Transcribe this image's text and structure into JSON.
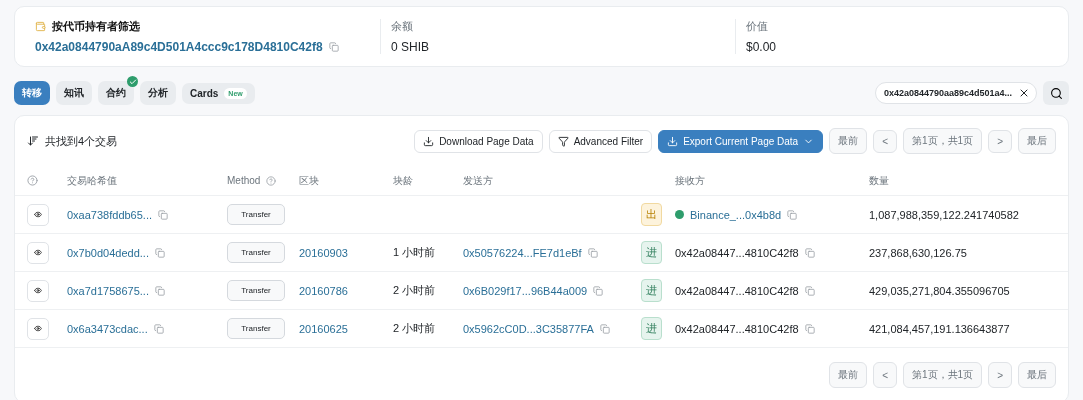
{
  "summary": {
    "filter": {
      "title": "按代币持有者筛选",
      "address": "0x42a0844790aA89c4D501A4ccc9c178D4810C42f8"
    },
    "balance": {
      "label": "余额",
      "value": "0 SHIB"
    },
    "value": {
      "label": "价值",
      "value": "$0.00"
    }
  },
  "tabs": [
    {
      "label": "转移",
      "selected": true,
      "verified": false
    },
    {
      "label": "知讯",
      "selected": false,
      "verified": false
    },
    {
      "label": "合约",
      "selected": false,
      "verified": true
    },
    {
      "label": "分析",
      "selected": false,
      "verified": false
    },
    {
      "label": "Cards",
      "selected": false,
      "verified": false,
      "badge": "New"
    }
  ],
  "search": {
    "value": "0x42a0844790aa89c4d501a4..."
  },
  "toolbar": {
    "count": "共找到4个交易",
    "download": "Download Page Data",
    "filter": "Advanced Filter",
    "export": "Export Current Page Data",
    "pagination": {
      "first": "最前",
      "prev": "<",
      "page": "第1页，共1页",
      "next": ">",
      "last": "最后"
    }
  },
  "table": {
    "columns": [
      "交易哈希值",
      "Method",
      "区块",
      "块龄",
      "发送方",
      "",
      "接收方",
      "数量"
    ],
    "rows": [
      {
        "hash": "0xaa738fddb65...",
        "method": "Transfer",
        "direction": "出",
        "outgoing": true,
        "to": "Binance_...0x4b8d",
        "exchange": true,
        "amount": "1,087,988,359,122.241740582"
      },
      {
        "hash": "0x7b0d04dedd...",
        "method": "Transfer",
        "block": "20160903",
        "age": "1 小时前",
        "from": "0x50576224...FE7d1eBf",
        "direction": "进",
        "outgoing": false,
        "to": "0x42a08447...4810C42f8",
        "exchange": false,
        "amount": "237,868,630,126.75"
      },
      {
        "hash": "0xa7d1758675...",
        "method": "Transfer",
        "block": "20160786",
        "age": "2 小时前",
        "from": "0x6B029f17...96B44a009",
        "direction": "进",
        "outgoing": false,
        "to": "0x42a08447...4810C42f8",
        "exchange": false,
        "amount": "429,035,271,804.355096705"
      },
      {
        "hash": "0x6a3473cdac...",
        "method": "Transfer",
        "block": "20160625",
        "age": "2 小时前",
        "from": "0x5962cC0D...3C35877FA",
        "direction": "进",
        "outgoing": false,
        "to": "0x42a08447...4810C42f8",
        "exchange": false,
        "amount": "421,084,457,191.136643877"
      }
    ]
  },
  "footer_pagination": {
    "first": "最前",
    "prev": "<",
    "page": "第1页，共1页",
    "next": ">",
    "last": "最后"
  }
}
